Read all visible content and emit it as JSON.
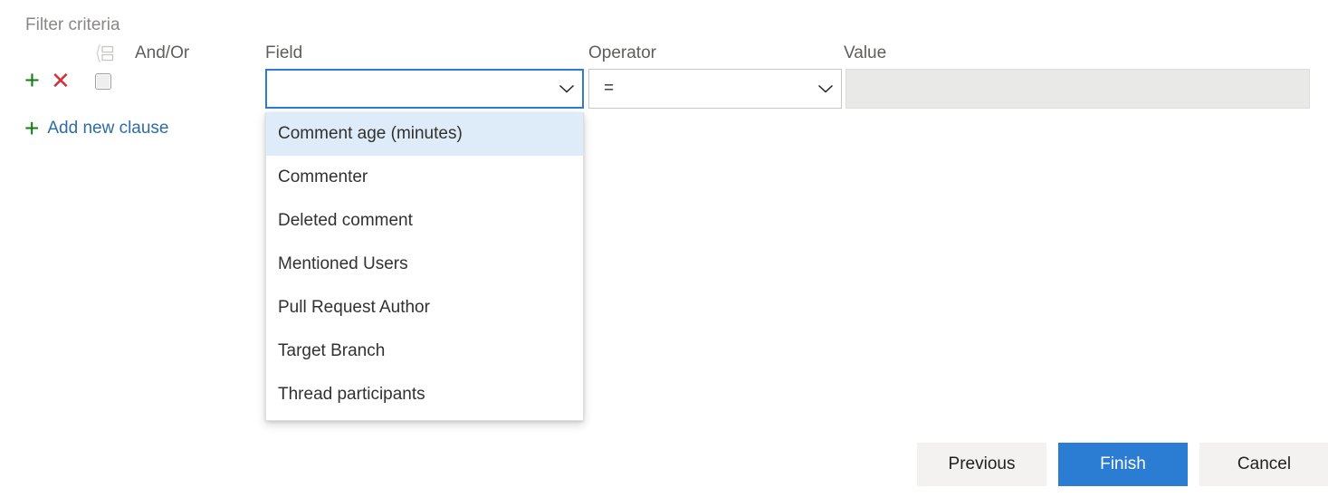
{
  "panel": {
    "section_title": "Filter criteria",
    "headers": {
      "group": "",
      "and_or": "And/Or",
      "field": "Field",
      "operator": "Operator",
      "value": "Value"
    },
    "group_icon": "group-brace-icon",
    "row": {
      "add_icon": "plus-icon",
      "add_icon_glyph": "+",
      "delete_icon": "close-icon",
      "delete_icon_glyph": "✕",
      "checkbox_checked": false,
      "field_value": "",
      "field_placeholder": "",
      "operator_value": "=",
      "value_value": "",
      "value_disabled": true,
      "chevron_glyph": "⌄"
    },
    "add_clause": {
      "icon": "plus-icon",
      "icon_glyph": "+",
      "label": "Add new clause"
    }
  },
  "dropdown": {
    "open": true,
    "selected_index": 0,
    "items": [
      "Comment age (minutes)",
      "Commenter",
      "Deleted comment",
      "Mentioned Users",
      "Pull Request Author",
      "Target Branch",
      "Thread participants"
    ]
  },
  "footer": {
    "previous_label": "Previous",
    "finish_label": "Finish",
    "cancel_label": "Cancel"
  },
  "colors": {
    "accent_blue": "#2b7cd3",
    "link_blue": "#2d6ca8",
    "plus_green": "#107c10",
    "delete_red": "#d13438",
    "highlight_blue": "#deecf9",
    "button_grey": "#f3f2f1",
    "disabled_grey": "#e9e9e7"
  }
}
